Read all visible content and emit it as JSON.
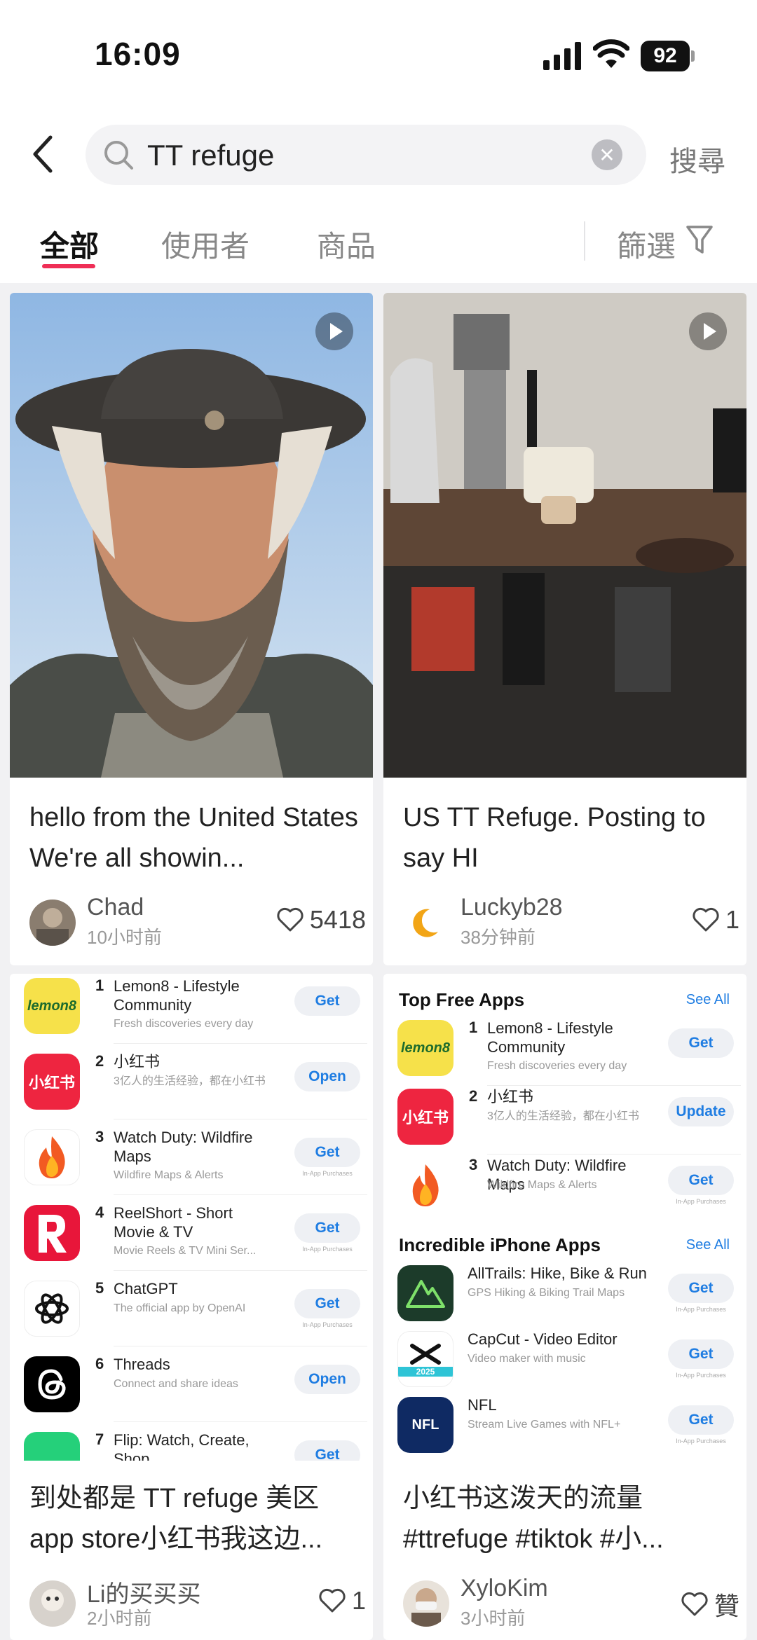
{
  "status_bar": {
    "time": "16:09",
    "battery": "92"
  },
  "search": {
    "query": "TT refuge",
    "button_label": "搜尋"
  },
  "tabs": [
    {
      "label": "全部",
      "active": true
    },
    {
      "label": "使用者",
      "active": false
    },
    {
      "label": "商品",
      "active": false
    }
  ],
  "filter": {
    "label": "篩選"
  },
  "posts": [
    {
      "caption": "hello from the United States We're all showin...",
      "author": "Chad",
      "ago": "10小时前",
      "likes": "5418",
      "is_video": true
    },
    {
      "caption": "US TT Refuge. Posting to say HI",
      "author": "Luckyb28",
      "ago": "38分钟前",
      "likes": "1",
      "is_video": true
    },
    {
      "caption": "到处都是 TT refuge 美区 app store小红书我这边...",
      "author": "Li的买买买",
      "ago": "2小时前",
      "likes": "1"
    },
    {
      "caption": "小红书这泼天的流量 #ttrefuge  #tiktok  #小...",
      "author": "XyloKim",
      "ago": "3小时前",
      "likes": "贊"
    }
  ],
  "store_left": {
    "apps": [
      {
        "rank": "1",
        "name": "Lemon8 - Lifestyle Community",
        "sub": "Fresh discoveries every day",
        "button": "Get",
        "icon": "lemon8-icon",
        "iap": ""
      },
      {
        "rank": "2",
        "name": "小红书",
        "sub": "3亿人的生活经验，都在小红书",
        "button": "Open",
        "icon": "xiaohongshu-icon",
        "iap": ""
      },
      {
        "rank": "3",
        "name": "Watch Duty: Wildfire Maps",
        "sub": "Wildfire Maps & Alerts",
        "button": "Get",
        "icon": "flame-icon",
        "iap": "In-App Purchases"
      },
      {
        "rank": "4",
        "name": "ReelShort - Short Movie & TV",
        "sub": "Movie Reels & TV Mini Ser...",
        "button": "Get",
        "icon": "reelshort-icon",
        "iap": "In-App Purchases"
      },
      {
        "rank": "5",
        "name": "ChatGPT",
        "sub": "The official app by OpenAI",
        "button": "Get",
        "icon": "chatgpt-icon",
        "iap": "In-App Purchases"
      },
      {
        "rank": "6",
        "name": "Threads",
        "sub": "Connect and share ideas",
        "button": "Open",
        "icon": "threads-icon",
        "iap": ""
      },
      {
        "rank": "7",
        "name": "Flip: Watch, Create, Shop",
        "sub": "",
        "button": "Get",
        "icon": "flip-icon",
        "iap": ""
      }
    ]
  },
  "store_right": {
    "top_title": "Top Free Apps",
    "see_all": "See All",
    "top_apps": [
      {
        "rank": "1",
        "name": "Lemon8 - Lifestyle Community",
        "sub": "Fresh discoveries every day",
        "button": "Get",
        "iap": ""
      },
      {
        "rank": "2",
        "name": "小红书",
        "sub": "3亿人的生活经验，都在小红书",
        "button": "Update",
        "iap": ""
      },
      {
        "rank": "3",
        "name": "Watch Duty: Wildfire Maps",
        "sub": "Wildfire Maps & Alerts",
        "button": "Get",
        "iap": "In-App Purchases"
      }
    ],
    "iphone_title": "Incredible iPhone Apps",
    "iphone_apps": [
      {
        "name": "AllTrails: Hike, Bike & Run",
        "sub": "GPS Hiking & Biking Trail Maps",
        "button": "Get",
        "iap": "In-App Purchases"
      },
      {
        "name": "CapCut - Video Editor",
        "sub": "Video maker with music",
        "button": "Get",
        "iap": "In-App Purchases"
      },
      {
        "name": "NFL",
        "sub": "Stream Live Games with NFL+",
        "button": "Get",
        "iap": "In-App Purchases"
      }
    ],
    "icon_labels": {
      "lemon8": "lemon8",
      "xhs": "小红书",
      "capcut_year": "2025",
      "nfl": "NFL"
    }
  },
  "colors": {
    "accent": "#ef2e56",
    "store_blue": "#1f7de2"
  }
}
